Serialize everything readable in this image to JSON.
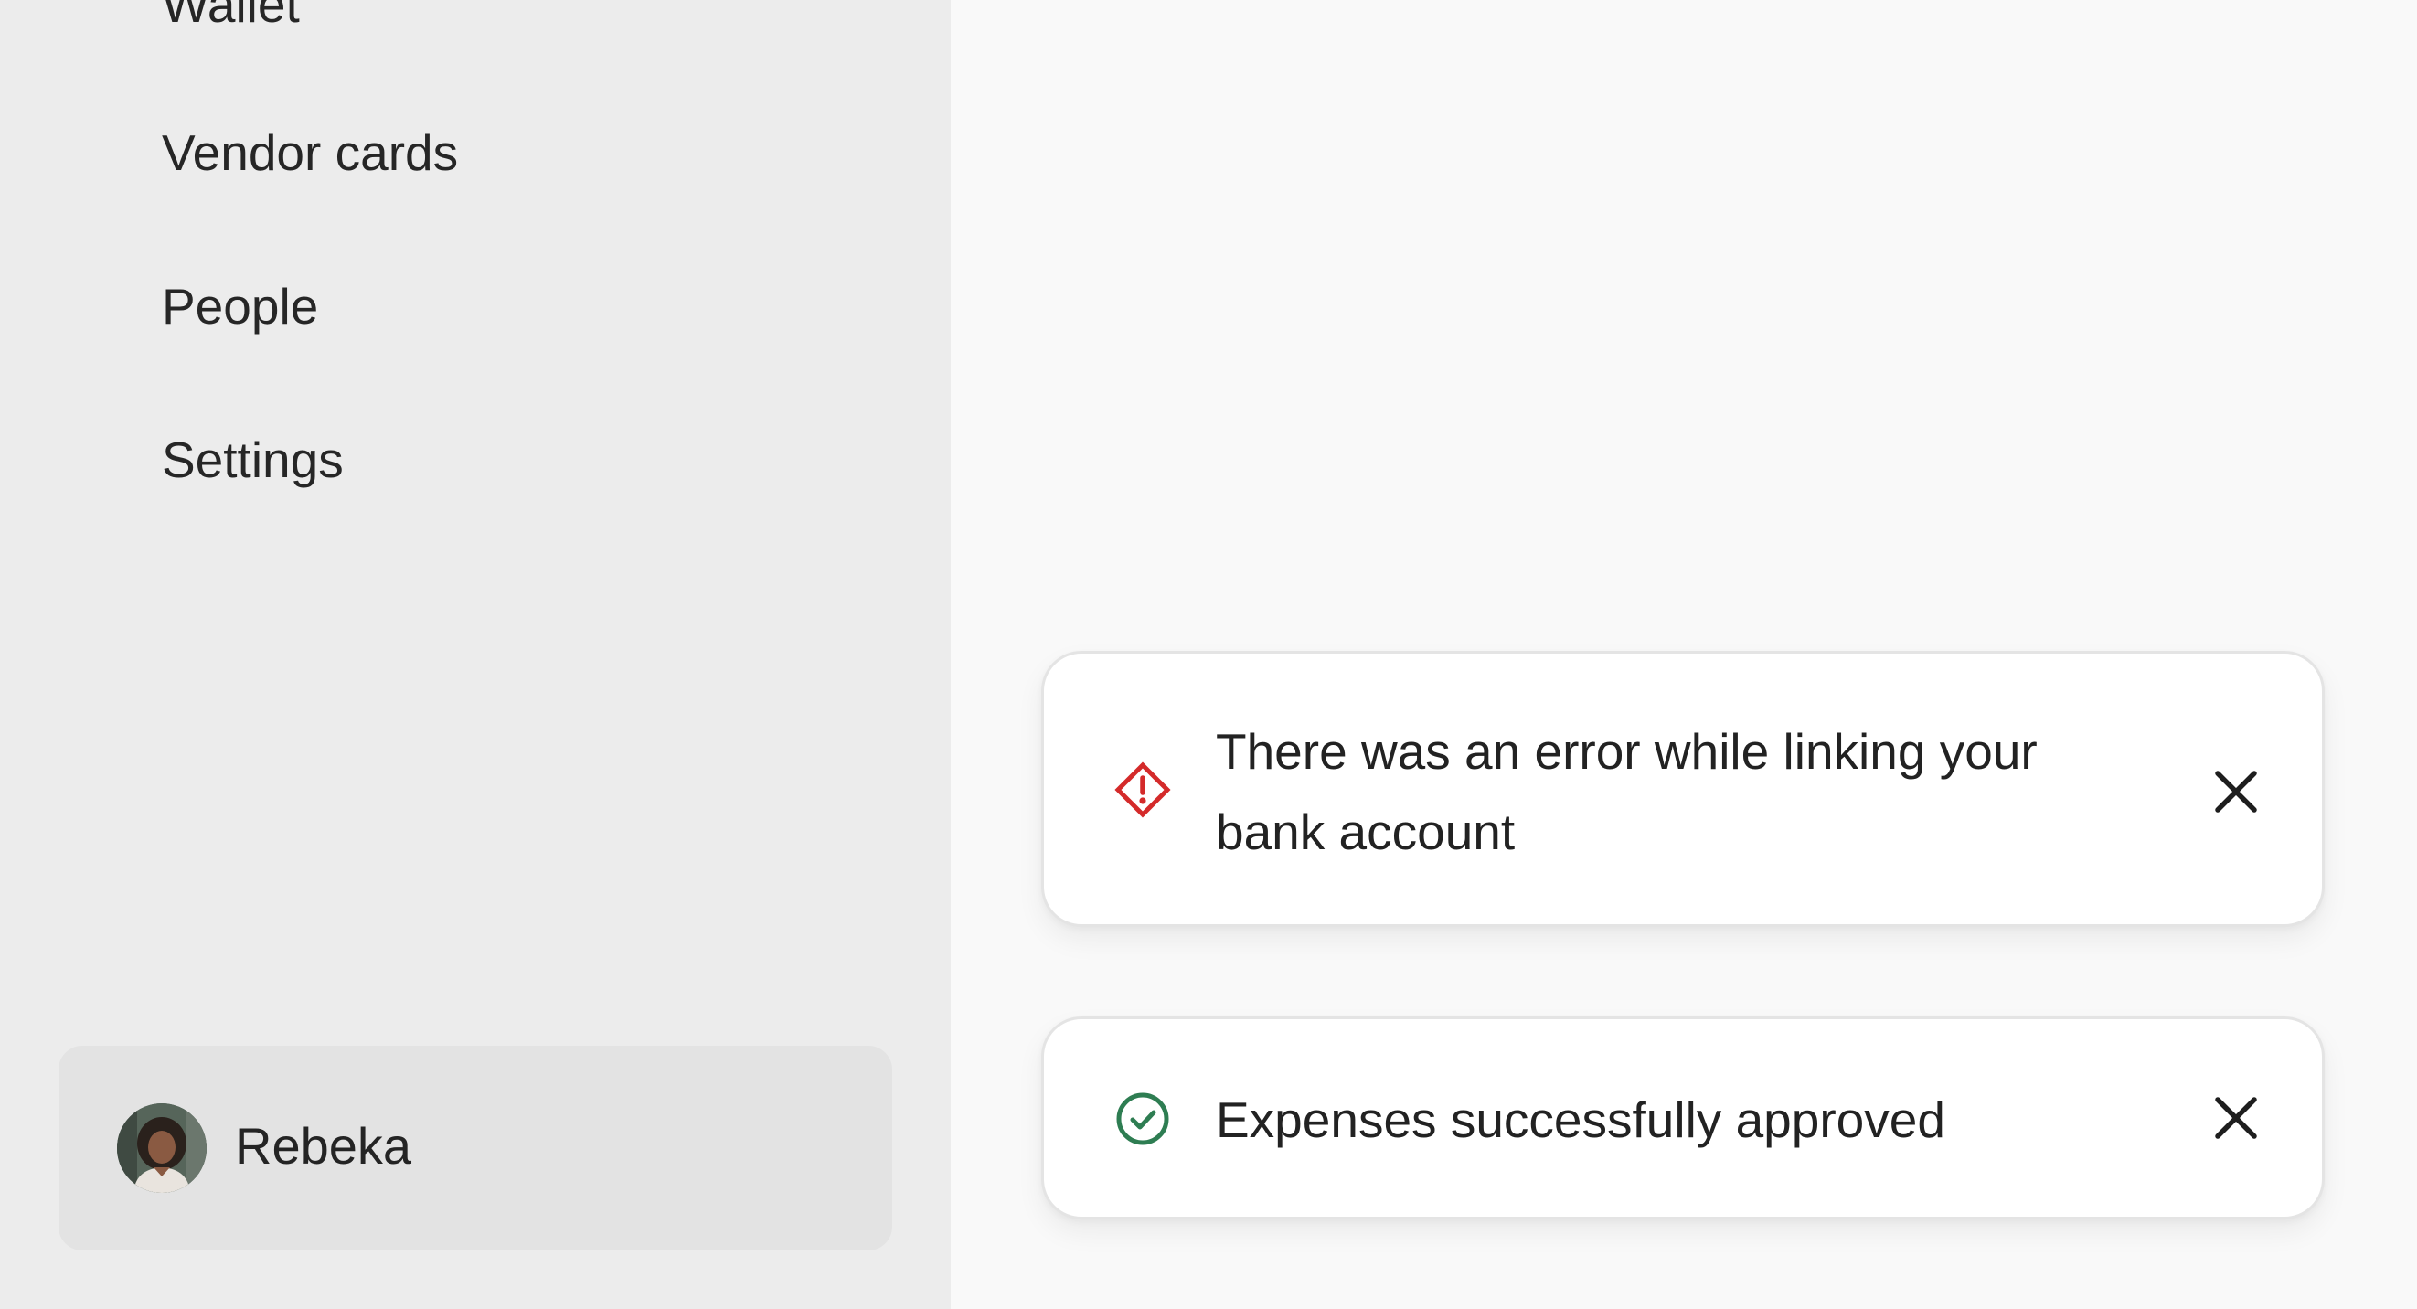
{
  "sidebar": {
    "items": [
      {
        "label": "Wallet"
      },
      {
        "label": "Vendor cards"
      },
      {
        "label": "People"
      },
      {
        "label": "Settings"
      }
    ],
    "user": {
      "name": "Rebeka",
      "avatar_icon": "user-avatar-photo"
    }
  },
  "toasts": [
    {
      "type": "error",
      "icon": "warning-diamond-icon",
      "message": "There was an error while linking your bank account",
      "close_icon": "close-icon",
      "color": "#d42a2a"
    },
    {
      "type": "success",
      "icon": "check-circle-icon",
      "message": "Expenses successfully approved",
      "close_icon": "close-icon",
      "color": "#2e7d52"
    }
  ],
  "colors": {
    "sidebar_bg": "#ececec",
    "main_bg": "#f9f9f9",
    "user_card_bg": "#e3e3e3",
    "error": "#d42a2a",
    "success": "#2e7d52"
  }
}
